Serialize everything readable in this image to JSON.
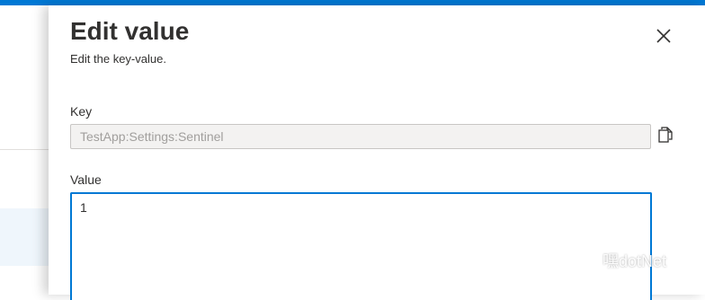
{
  "panel": {
    "title": "Edit value",
    "subtitle": "Edit the key-value.",
    "close_icon": "close-icon"
  },
  "key": {
    "label": "Key",
    "value": "TestApp:Settings:Sentinel",
    "copy_icon": "copy-icon"
  },
  "value": {
    "label": "Value",
    "content": "1"
  },
  "watermark": {
    "text": "嘿dotNet",
    "icon": "wechat-icon"
  },
  "colors": {
    "accent": "#0078d4",
    "disabled_bg": "#f3f2f1",
    "text": "#323130"
  }
}
